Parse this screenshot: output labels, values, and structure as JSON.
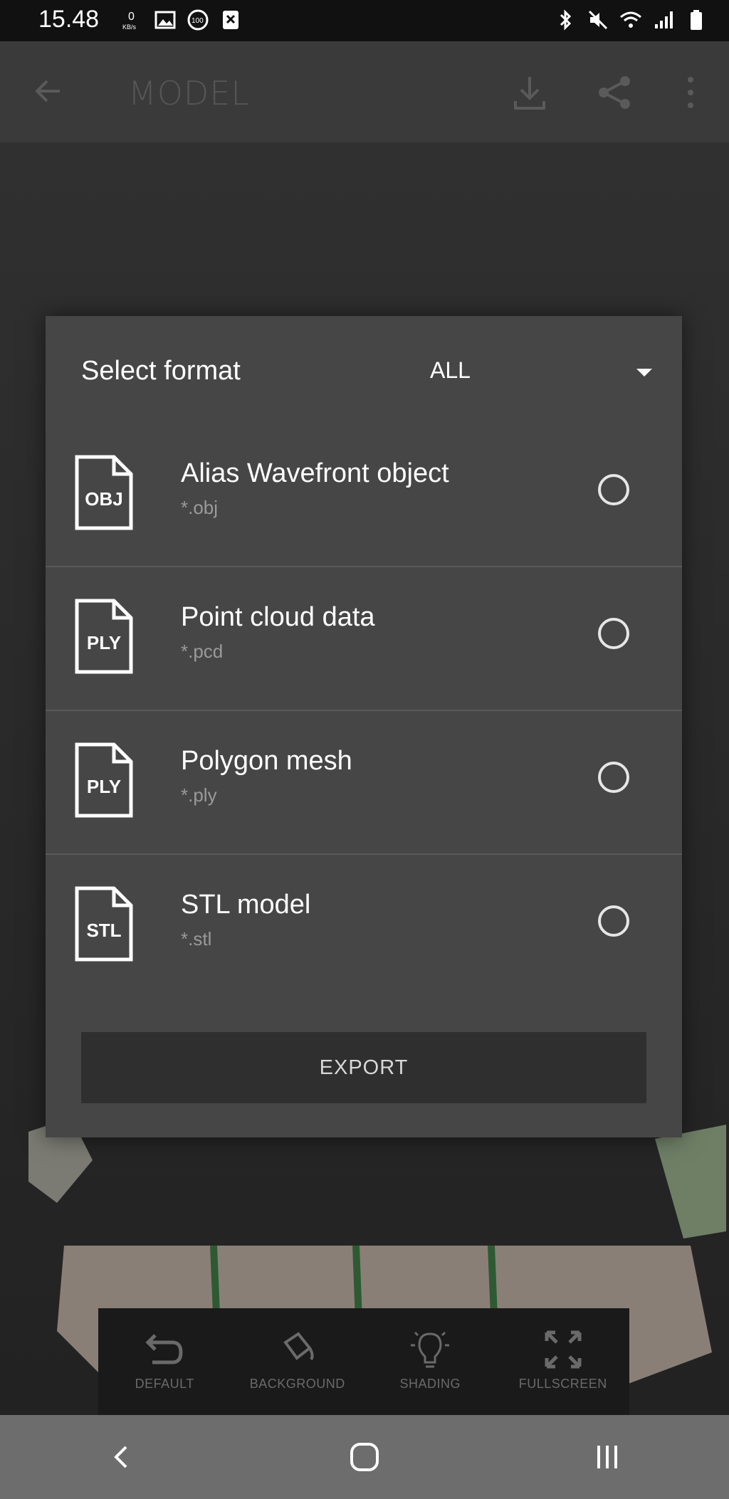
{
  "status_bar": {
    "time": "15.48",
    "icons_left": [
      "kb-per-second-icon",
      "image-icon",
      "badge-100-icon",
      "close-box-icon"
    ],
    "icons_right": [
      "bluetooth-icon",
      "mute-icon",
      "wifi-icon",
      "signal-icon",
      "battery-icon"
    ]
  },
  "app_bar": {
    "title": "MODEL",
    "actions": [
      "download-icon",
      "share-icon",
      "more-icon"
    ]
  },
  "dialog": {
    "title": "Select format",
    "filter_value": "ALL",
    "formats": [
      {
        "name": "Alias Wavefront object",
        "ext": "*.obj",
        "badge": "OBJ"
      },
      {
        "name": "Point cloud data",
        "ext": "*.pcd",
        "badge": "PLY"
      },
      {
        "name": "Polygon mesh",
        "ext": "*.ply",
        "badge": "PLY"
      },
      {
        "name": "STL model",
        "ext": "*.stl",
        "badge": "STL"
      }
    ],
    "export_label": "EXPORT"
  },
  "toolbar": {
    "default_label": "DEFAULT",
    "background_label": "BACKGROUND",
    "shading_label": "SHADING",
    "fullscreen_label": "FULLSCREEN"
  },
  "colors": {
    "dialog_bg": "#464646",
    "export_bg": "#2f2f2f",
    "nav_bg": "#6d6d6d"
  }
}
